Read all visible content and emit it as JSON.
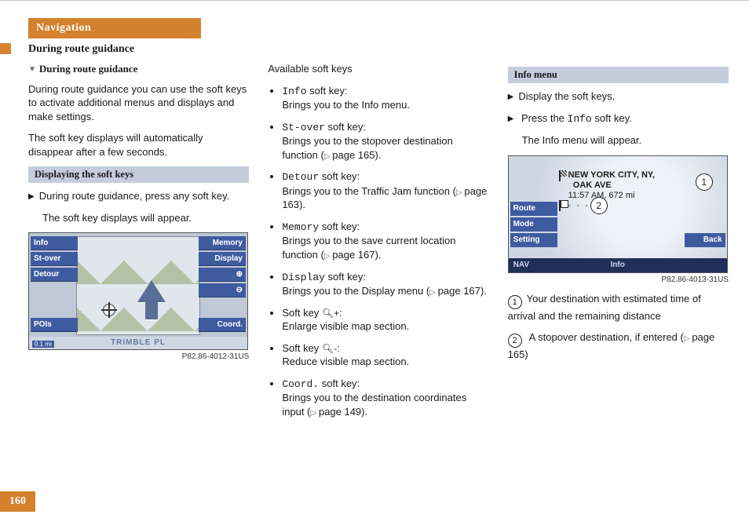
{
  "page_number": "160",
  "nav_label": "Navigation",
  "section_header": "During route guidance",
  "col1": {
    "subhead": "During route guidance",
    "p1": "During route guidance you can use the soft keys to activate additional menus and displays and make settings.",
    "p2": "The soft key displays will automatically disappear after a few seconds.",
    "box1_head": "Displaying the soft keys",
    "action1": "During route guidance, press any soft key.",
    "result1": "The soft key displays will appear.",
    "fig": {
      "left_keys": [
        "Info",
        "St-over",
        "Detour",
        "POIs"
      ],
      "right_keys": [
        "Memory",
        "Display",
        "⊕",
        "⊖",
        "Coord."
      ],
      "road": "TRIMBLE PL",
      "scale": "0.1 mi",
      "caption": "P82.86-4012-31US"
    }
  },
  "col2": {
    "lead": "Available soft keys",
    "items": [
      {
        "key": "Info",
        "text_a": " soft key:",
        "text_b": "Brings you to the Info menu."
      },
      {
        "key": "St-over",
        "text_a": " soft key:",
        "text_b": "Brings you to the stopover destination function (",
        "page": "page 165",
        "tail": ")."
      },
      {
        "key": "Detour",
        "text_a": " soft key:",
        "text_b": "Brings you to the Traffic Jam function (",
        "page": "page 163",
        "tail": ")."
      },
      {
        "key": "Memory",
        "text_a": " soft key:",
        "text_b": "Brings you to the save current location function (",
        "page": "page 167",
        "tail": ")."
      },
      {
        "key": "Display",
        "text_a": " soft key:",
        "text_b": "Brings you to the Display menu (",
        "page": "page 167",
        "tail": ")."
      },
      {
        "plain": "Soft key ",
        "glyph": "🔍+",
        "text_b": "Enlarge visible map section."
      },
      {
        "plain": "Soft key ",
        "glyph": "🔍-",
        "text_b": "Reduce visible map section."
      },
      {
        "key": "Coord.",
        "text_a": " soft key:",
        "text_b": "Brings you to the destination coordinates input (",
        "page": "page 149",
        "tail": ")."
      }
    ]
  },
  "col3": {
    "box_head": "Info menu",
    "action1": "Display the soft keys.",
    "action2_pre": "Press the ",
    "action2_key": "Info",
    "action2_post": " soft key.",
    "result": "The Info menu will appear.",
    "fig": {
      "left_keys": [
        "Route",
        "Mode",
        "Setting"
      ],
      "back": "Back",
      "bar_left": "NAV",
      "bar_mid": "Info",
      "dest_city": "NEW YORK CITY, NY,",
      "dest_street": "OAK AVE",
      "eta": "11:57 AM, 672 mi",
      "caption": "P82.86-4013-31US"
    },
    "legend1": "Your destination with estimated time of arrival and the remaining distance",
    "legend2_a": "A stopover destination, if entered (",
    "legend2_page": "page 165",
    "legend2_b": ")"
  }
}
